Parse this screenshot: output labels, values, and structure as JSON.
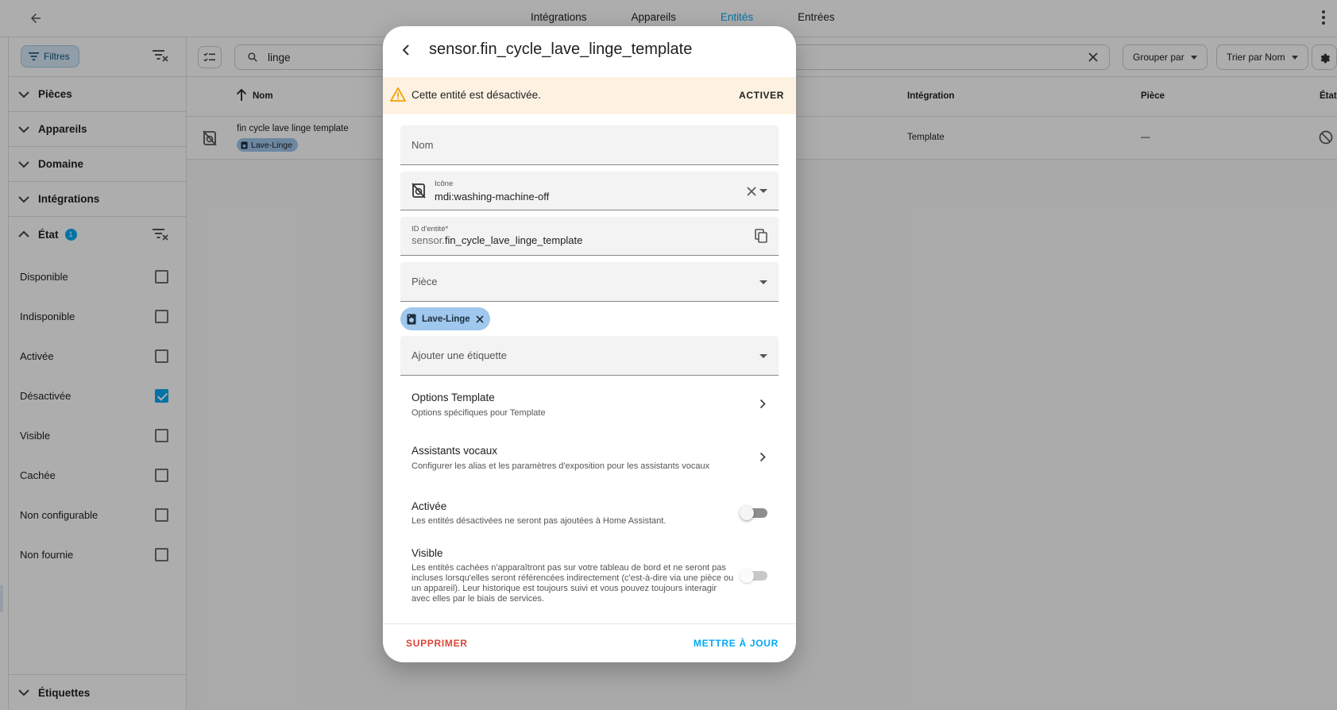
{
  "topbar": {
    "tabs": [
      {
        "label": "Intégrations",
        "active": false
      },
      {
        "label": "Appareils",
        "active": false
      },
      {
        "label": "Entités",
        "active": true
      },
      {
        "label": "Entrées",
        "active": false
      }
    ]
  },
  "filters": {
    "button_label": "Filtres",
    "sections": {
      "pieces": "Pièces",
      "appareils": "Appareils",
      "domaine": "Domaine",
      "integrations": "Intégrations",
      "etat": "État",
      "etat_badge": "1",
      "etiquettes": "Étiquettes"
    },
    "state_options": [
      {
        "label": "Disponible",
        "checked": false
      },
      {
        "label": "Indisponible",
        "checked": false
      },
      {
        "label": "Activée",
        "checked": false
      },
      {
        "label": "Désactivée",
        "checked": true
      },
      {
        "label": "Visible",
        "checked": false
      },
      {
        "label": "Cachée",
        "checked": false
      },
      {
        "label": "Non configurable",
        "checked": false
      },
      {
        "label": "Non fournie",
        "checked": false
      }
    ]
  },
  "toolbar": {
    "search_value": "linge",
    "group_by": "Grouper par",
    "sort_by": "Trier par Nom"
  },
  "table": {
    "headers": {
      "name": "Nom",
      "integration": "Intégration",
      "piece": "Pièce",
      "status": "État"
    },
    "rows": [
      {
        "name": "fin cycle lave linge template",
        "label": "Lave-Linge",
        "integration": "Template",
        "piece": "—"
      }
    ]
  },
  "dialog": {
    "title": "sensor.fin_cycle_lave_linge_template",
    "warning_text": "Cette entité est désactivée.",
    "warning_action": "ACTIVER",
    "name_label": "Nom",
    "icon_label": "Icône",
    "icon_value": "mdi:washing-machine-off",
    "entity_id_label": "ID d'entité*",
    "entity_id_prefix": "sensor.",
    "entity_id_value": "fin_cycle_lave_linge_template",
    "piece_label": "Pièce",
    "chip_label": "Lave-Linge",
    "add_label": "Ajouter une étiquette",
    "options_title": "Options Template",
    "options_subtitle": "Options spécifiques pour Template",
    "voice_title": "Assistants vocaux",
    "voice_subtitle": "Configurer les alias et les paramètres d'exposition pour les assistants vocaux",
    "enabled_title": "Activée",
    "enabled_desc": "Les entités désactivées ne seront pas ajoutées à Home Assistant.",
    "enabled_on": false,
    "visible_title": "Visible",
    "visible_desc": "Les entités cachées n'apparaîtront pas sur votre tableau de bord et ne seront pas incluses lorsqu'elles seront référencées indirectement (c'est-à-dire via une pièce ou un appareil). Leur historique est toujours suivi et vous pouvez toujours interagir avec elles par le biais de services.",
    "visible_on": false,
    "delete_label": "SUPPRIMER",
    "update_label": "METTRE À JOUR"
  },
  "colors": {
    "accent": "#03a9f4",
    "danger": "#db4437",
    "warning_bg": "#fdf2e2",
    "chip_bg": "#a0c8ee"
  }
}
